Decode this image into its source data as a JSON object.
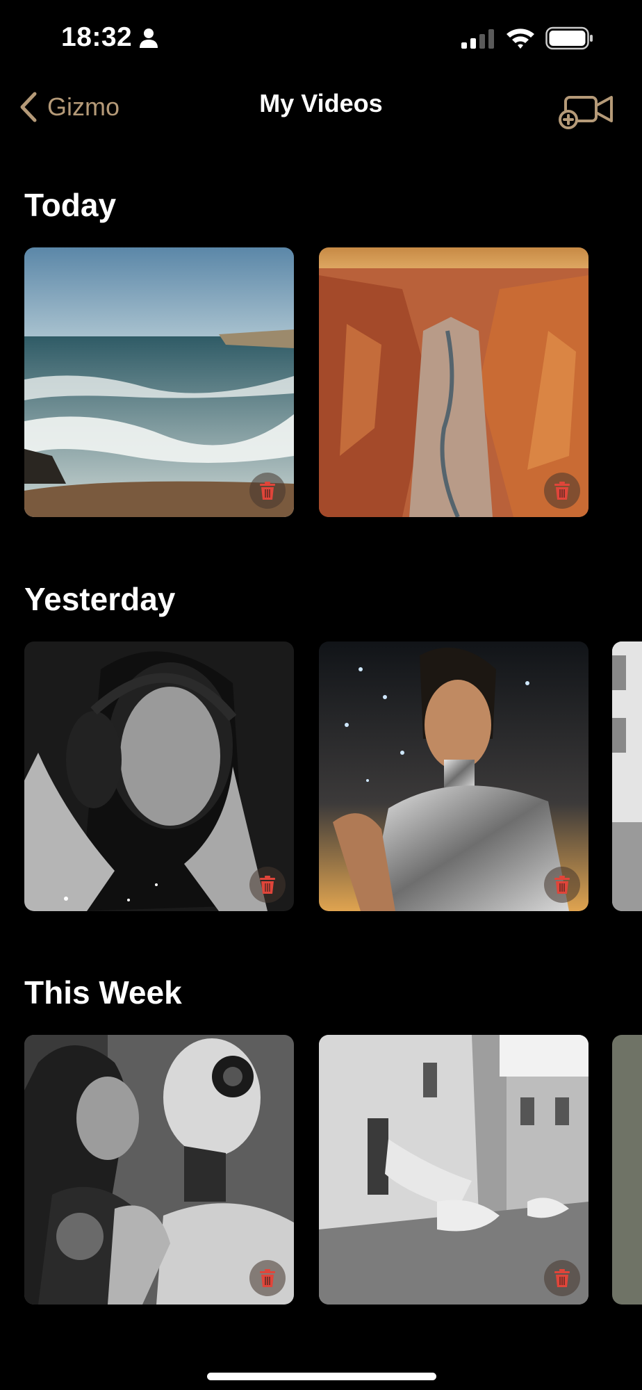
{
  "status_bar": {
    "time": "18:32"
  },
  "nav": {
    "back_label": "Gizmo",
    "title": "My Videos"
  },
  "colors": {
    "accent": "#B59A78",
    "delete": "#E0453A",
    "background": "#000000"
  },
  "sections": [
    {
      "title": "Today",
      "videos": [
        "ocean-waves",
        "canyon-river"
      ]
    },
    {
      "title": "Yesterday",
      "videos": [
        "woman-headphones",
        "woman-silver-outfit",
        "building-partial"
      ]
    },
    {
      "title": "This Week",
      "videos": [
        "woman-robot-embrace",
        "street-fishing-boat",
        "partial-thumbnail"
      ]
    }
  ]
}
